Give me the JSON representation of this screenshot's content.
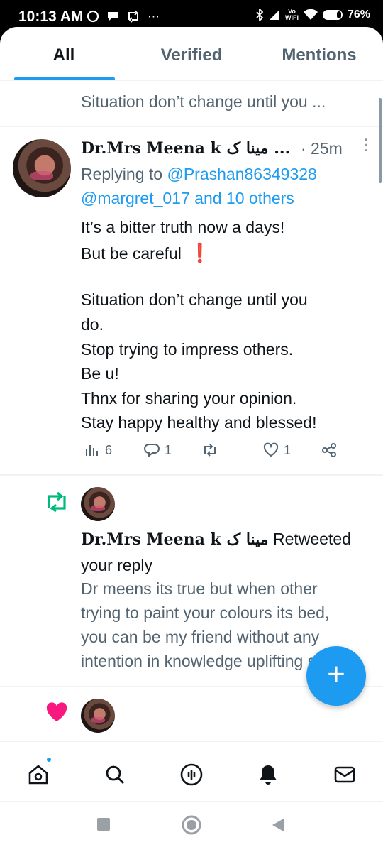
{
  "status_bar": {
    "time": "10:13 AM",
    "left_icons": [
      "whatsapp-icon",
      "chat-bubble-icon",
      "retweet-notification-icon",
      "more-dots-icon"
    ],
    "more_dots": "···",
    "vowifi_top": "Vo",
    "vowifi_bottom": "WiFi",
    "battery": "76%"
  },
  "tabs": [
    {
      "label": "All",
      "active": true
    },
    {
      "label": "Verified",
      "active": false
    },
    {
      "label": "Mentions",
      "active": false
    }
  ],
  "snippet": "Situation don’t change until you ...",
  "tweet": {
    "author": "Dr.Mrs Meena k مینا ک ...",
    "time": "· 25m",
    "replying_prefix": "Replying to ",
    "replying_to_1": "@Prashan86349328",
    "replying_to_2": "@margret_017 and 10 others",
    "lines": [
      "It’s a bitter truth now a days!",
      "But be careful",
      "Situation don’t change until you",
      "do.",
      "Stop trying to impress others.",
      "Be u!",
      "Thnx for sharing your opinion.",
      "Stay happy healthy and blessed!"
    ],
    "exclamation": "❗",
    "actions": {
      "views": "6",
      "replies": "1",
      "retweets": "",
      "likes": "1"
    }
  },
  "retweet_notification": {
    "author": "Dr.Mrs Meena k مینا ک",
    "action_suffix": " Retweeted",
    "action_line2": "your reply",
    "quote_lines": [
      "Dr meens its true but when other",
      "trying to paint your colours its bed,",
      "you can be my friend without any",
      "intention in knowledge uplifting s..."
    ]
  },
  "fab_label": "+",
  "bottom_nav": [
    "home-icon",
    "search-icon",
    "spaces-icon",
    "notifications-icon",
    "messages-icon"
  ],
  "colors": {
    "accent": "#1d9bf0",
    "retweet": "#00ba7c",
    "like": "#f91880",
    "secondary_text": "#536471"
  }
}
